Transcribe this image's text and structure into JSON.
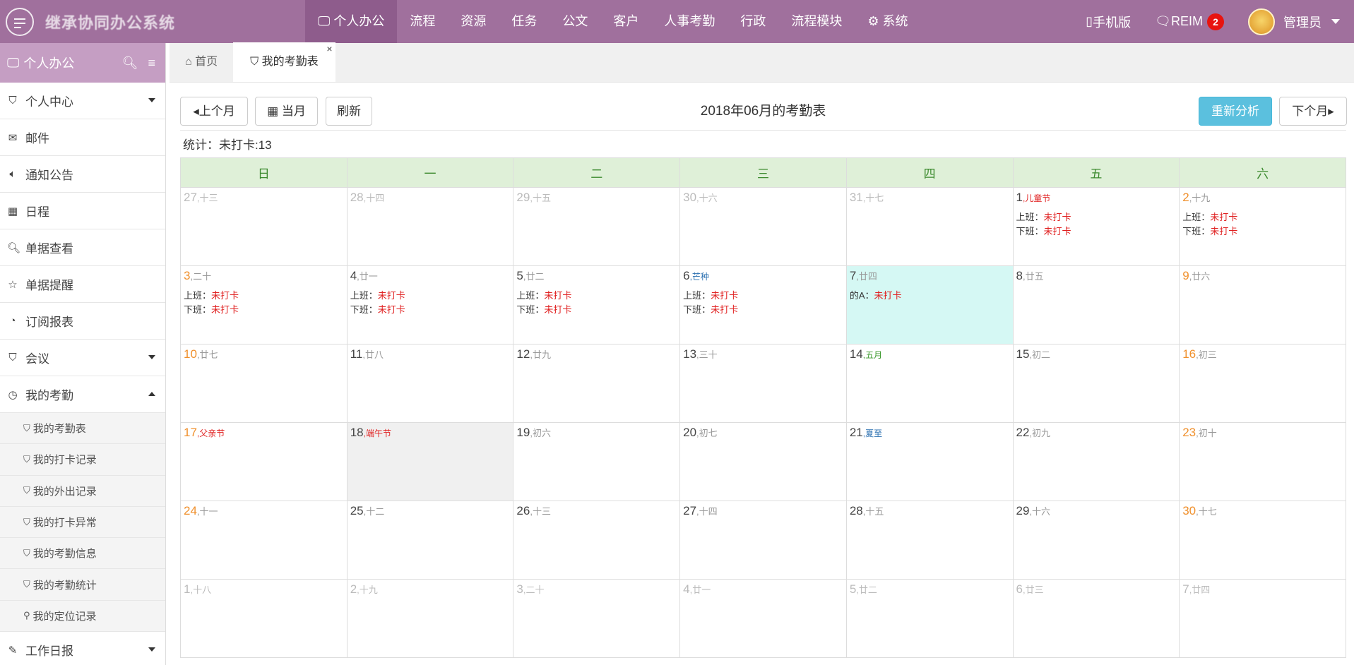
{
  "header": {
    "app_title": "继承协同办公系统",
    "nav": [
      "个人办公",
      "流程",
      "资源",
      "任务",
      "公文",
      "客户",
      "人事考勤",
      "行政",
      "流程模块",
      "系统"
    ],
    "nav_active": "个人办公",
    "mobile": "手机版",
    "reim": "REIM",
    "reim_badge": "2",
    "user": "管理员"
  },
  "sidebar": {
    "title": "个人办公",
    "items": [
      {
        "label": "个人中心",
        "icon": "bookmark-icon",
        "arrow": "down"
      },
      {
        "label": "邮件",
        "icon": "envelope-icon"
      },
      {
        "label": "通知公告",
        "icon": "volume-icon"
      },
      {
        "label": "日程",
        "icon": "calendar-icon"
      },
      {
        "label": "单据查看",
        "icon": "search-icon"
      },
      {
        "label": "单据提醒",
        "icon": "star-icon"
      },
      {
        "label": "订阅报表",
        "icon": "rss-icon"
      },
      {
        "label": "会议",
        "icon": "bookmark-icon",
        "arrow": "down"
      },
      {
        "label": "我的考勤",
        "icon": "clock-icon",
        "arrow": "up"
      }
    ],
    "subitems": [
      "我的考勤表",
      "我的打卡记录",
      "我的外出记录",
      "我的打卡异常",
      "我的考勤信息",
      "我的考勤统计",
      "我的定位记录"
    ],
    "last_item": "工作日报"
  },
  "tabs": {
    "home": "首页",
    "current": "我的考勤表",
    "close": "×"
  },
  "toolbar": {
    "prev": "上个月",
    "current": "当月",
    "refresh": "刷新",
    "title": "2018年06月的考勤表",
    "reanalyze": "重新分析",
    "next": "下个月"
  },
  "stats": "统计：未打卡:13",
  "calendar": {
    "weekdays": [
      "日",
      "一",
      "二",
      "三",
      "四",
      "五",
      "六"
    ],
    "labels": {
      "on": "上班：",
      "off": "下班：",
      "other": "的A：",
      "missed": "未打卡"
    },
    "weeks": [
      [
        {
          "d": "27",
          "l": "十三",
          "o": true
        },
        {
          "d": "28",
          "l": "十四",
          "o": true
        },
        {
          "d": "29",
          "l": "十五",
          "o": true
        },
        {
          "d": "30",
          "l": "十六",
          "o": true
        },
        {
          "d": "31",
          "l": "十七",
          "o": true
        },
        {
          "d": "1",
          "l": "儿童节",
          "f": "fest",
          "r": "both"
        },
        {
          "d": "2",
          "l": "十九",
          "r": "both",
          "w": true
        }
      ],
      [
        {
          "d": "3",
          "l": "二十",
          "r": "both",
          "w": true
        },
        {
          "d": "4",
          "l": "廿一",
          "r": "both"
        },
        {
          "d": "5",
          "l": "廿二",
          "r": "both"
        },
        {
          "d": "6",
          "l": "芒种",
          "f": "term",
          "r": "both"
        },
        {
          "d": "7",
          "l": "廿四",
          "r": "a",
          "today": true
        },
        {
          "d": "8",
          "l": "廿五"
        },
        {
          "d": "9",
          "l": "廿六",
          "w": true
        }
      ],
      [
        {
          "d": "10",
          "l": "廿七",
          "w": true
        },
        {
          "d": "11",
          "l": "廿八"
        },
        {
          "d": "12",
          "l": "廿九"
        },
        {
          "d": "13",
          "l": "三十"
        },
        {
          "d": "14",
          "l": "五月",
          "f": "mth"
        },
        {
          "d": "15",
          "l": "初二"
        },
        {
          "d": "16",
          "l": "初三",
          "w": true
        }
      ],
      [
        {
          "d": "17",
          "l": "父亲节",
          "f": "fest",
          "w": true
        },
        {
          "d": "18",
          "l": "端午节",
          "f": "fest",
          "hl": true
        },
        {
          "d": "19",
          "l": "初六"
        },
        {
          "d": "20",
          "l": "初七"
        },
        {
          "d": "21",
          "l": "夏至",
          "f": "term"
        },
        {
          "d": "22",
          "l": "初九"
        },
        {
          "d": "23",
          "l": "初十",
          "w": true
        }
      ],
      [
        {
          "d": "24",
          "l": "十一",
          "w": true
        },
        {
          "d": "25",
          "l": "十二"
        },
        {
          "d": "26",
          "l": "十三"
        },
        {
          "d": "27",
          "l": "十四"
        },
        {
          "d": "28",
          "l": "十五"
        },
        {
          "d": "29",
          "l": "十六"
        },
        {
          "d": "30",
          "l": "十七",
          "w": true
        }
      ],
      [
        {
          "d": "1",
          "l": "十八",
          "o": true
        },
        {
          "d": "2",
          "l": "十九",
          "o": true
        },
        {
          "d": "3",
          "l": "二十",
          "o": true
        },
        {
          "d": "4",
          "l": "廿一",
          "o": true
        },
        {
          "d": "5",
          "l": "廿二",
          "o": true
        },
        {
          "d": "6",
          "l": "廿三",
          "o": true
        },
        {
          "d": "7",
          "l": "廿四",
          "o": true
        }
      ]
    ]
  },
  "colors": {
    "topbar": "#a0709d",
    "nav_active": "#8e5c8c",
    "sidebar_head": "#c59ec3",
    "weekday_header": "#dff0d8",
    "today": "#d5f8f4",
    "weekend": "#f0902c",
    "missed": "#e02020",
    "primary": "#5bc0de"
  }
}
